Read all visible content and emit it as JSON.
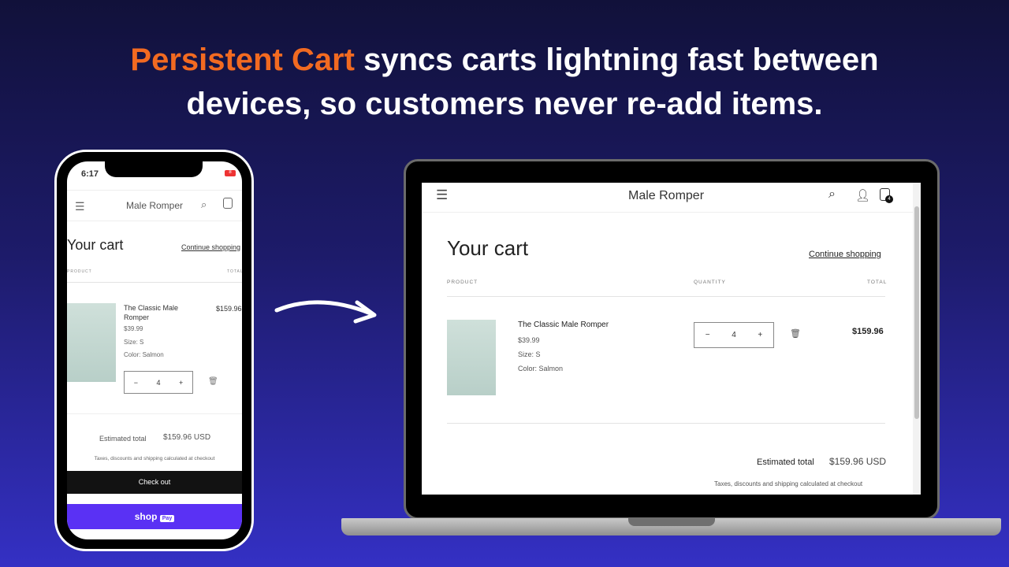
{
  "headline": {
    "accent": "Persistent Cart",
    "rest_line1": " syncs carts lightning fast between",
    "line2": "devices, so customers never re-add items."
  },
  "colors": {
    "accent": "#f26a21",
    "shop_pay": "#5a31f4"
  },
  "store": {
    "title": "Male Romper",
    "cart_count": "4"
  },
  "phone": {
    "time": "6:17",
    "battery": "8"
  },
  "cart": {
    "heading": "Your cart",
    "continue": "Continue shopping",
    "col_product": "PRODUCT",
    "col_quantity": "QUANTITY",
    "col_total": "TOTAL",
    "item": {
      "name": "The Classic Male Romper",
      "price": "$39.99",
      "size": "Size: S",
      "color": "Color: Salmon",
      "qty": "4",
      "line_total": "$159.96"
    },
    "estimated_label": "Estimated total",
    "estimated_value": "$159.96 USD",
    "tax_note": "Taxes, discounts and shipping calculated at checkout",
    "checkout": "Check out",
    "shop_pay": "shop",
    "pay": "Pay"
  }
}
